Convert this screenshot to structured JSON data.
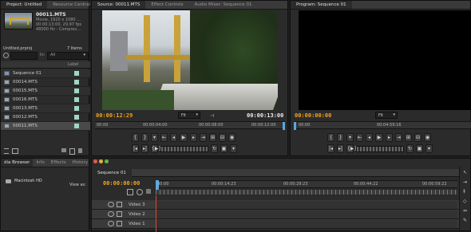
{
  "project": {
    "tabs": [
      "Project: Untitled",
      "Resource Central"
    ],
    "clip_name": "00011.MTS",
    "clip_info": [
      "Movie, 1920 x 1080 ...",
      "00:00:13:00, 29.97 fps",
      "48000 Hz - Compres..."
    ],
    "project_file": "Untitled.prproj",
    "item_count": "7 Items",
    "in_label": "In:",
    "in_value": "All",
    "col_label": "Label",
    "items": [
      "Sequence 01",
      "00014.MTS",
      "00015.MTS",
      "00016.MTS",
      "00013.MTS",
      "00012.MTS",
      "00011.MTS"
    ]
  },
  "source": {
    "tabs": [
      "Source: 00011.MTS",
      "Effect Controls",
      "Audio Mixer: Sequence 01"
    ],
    "timecode_left": "00:00:12:29",
    "fit": "Fit",
    "timecode_right": "00:00:13:00",
    "ruler": [
      "00:00",
      "00:00:04:00",
      "00:00:08:00",
      "00:00:12:00"
    ]
  },
  "program": {
    "tabs": [
      "Program: Sequence 01"
    ],
    "timecode_left": "00:00:00:00",
    "fit": "Fit",
    "ruler": [
      "00:00",
      "00:04:59:16"
    ]
  },
  "bottom_left": {
    "tabs": [
      "dia Browser",
      "Info",
      "Effects",
      "History"
    ],
    "drive": "Macintosh HD",
    "view_as": "View as:"
  },
  "timeline": {
    "tab": "Sequence 01",
    "timecode": "00:00:00:00",
    "ruler": [
      "00:00",
      "00:00:14:23",
      "00:00:29:23",
      "00:00:44:22",
      "00:00:59:22"
    ],
    "tracks": [
      "Video 3",
      "Video 2",
      "Video 1"
    ]
  },
  "colors": {
    "accent": "#f2a31b",
    "label_swatch": "#9fd6c4",
    "playhead": "#5aa7e0"
  }
}
